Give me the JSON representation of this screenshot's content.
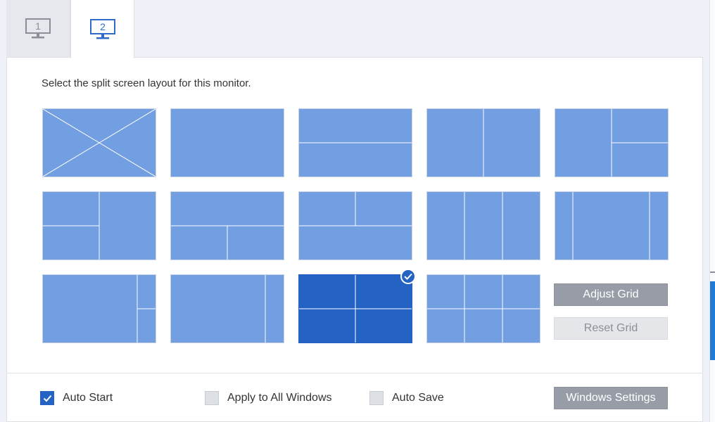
{
  "tabs": [
    {
      "label": "1",
      "state": "inactive"
    },
    {
      "label": "2",
      "state": "active"
    }
  ],
  "instruction": "Select the split screen layout for this monitor.",
  "layouts": [
    {
      "id": "none",
      "selected": false
    },
    {
      "id": "full",
      "selected": false
    },
    {
      "id": "two-rows",
      "selected": false
    },
    {
      "id": "two-columns",
      "selected": false
    },
    {
      "id": "left-plus-right-split",
      "selected": false
    },
    {
      "id": "left-split-plus-right",
      "selected": false
    },
    {
      "id": "top-plus-bottom-split",
      "selected": false
    },
    {
      "id": "top-split-plus-bottom",
      "selected": false
    },
    {
      "id": "three-columns",
      "selected": false
    },
    {
      "id": "narrow-wide-narrow",
      "selected": false
    },
    {
      "id": "wide-plus-right-split",
      "selected": false
    },
    {
      "id": "wide-plus-narrow-right",
      "selected": false
    },
    {
      "id": "grid-2x2",
      "selected": true
    },
    {
      "id": "grid-3x2",
      "selected": false
    }
  ],
  "buttons": {
    "adjust_grid": "Adjust Grid",
    "reset_grid": "Reset Grid",
    "windows_settings": "Windows Settings"
  },
  "options": {
    "auto_start": {
      "label": "Auto Start",
      "checked": true
    },
    "apply_all": {
      "label": "Apply to All Windows",
      "checked": false
    },
    "auto_save": {
      "label": "Auto Save",
      "checked": false
    }
  },
  "colors": {
    "tile": "#729ee2",
    "tile_selected": "#2462c4",
    "accent": "#2462c4",
    "button_gray": "#979ca7"
  },
  "icons": {
    "monitor": "monitor-icon",
    "check": "checkmark-icon"
  }
}
